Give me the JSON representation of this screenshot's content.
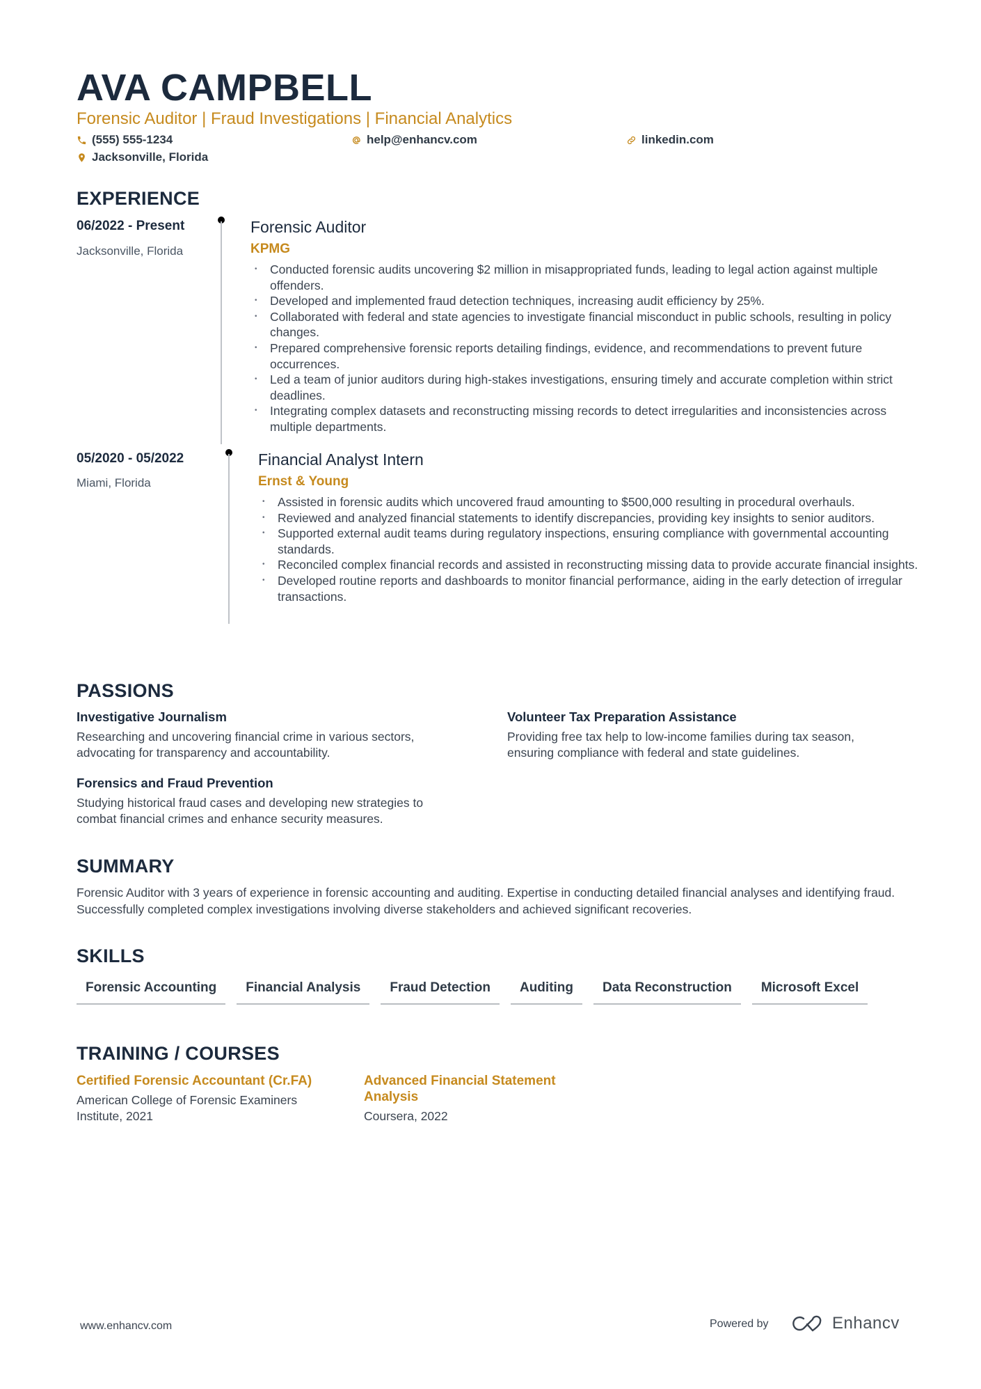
{
  "header": {
    "name": "AVA CAMPBELL",
    "headline": "Forensic Auditor | Fraud Investigations | Financial Analytics",
    "contacts": {
      "phone": {
        "icon": "phone-icon",
        "value": "(555) 555-1234"
      },
      "email": {
        "icon": "at-icon",
        "value": "help@enhancv.com"
      },
      "website": {
        "icon": "link-icon",
        "value": "linkedin.com"
      },
      "location": {
        "icon": "location-pin-icon",
        "value": "Jacksonville, Florida"
      }
    }
  },
  "colors": {
    "accent": "#c68a1e",
    "heading": "#1c2a3d",
    "text": "#3b4450"
  },
  "experience": {
    "title": "EXPERIENCE",
    "items": [
      {
        "dates": "06/2022 - Present",
        "location": "Jacksonville, Florida",
        "role": "Forensic Auditor",
        "company": "KPMG",
        "bullets": [
          "Conducted forensic audits uncovering $2 million in misappropriated funds, leading to legal action against multiple offenders.",
          "Developed and implemented fraud detection techniques, increasing audit efficiency by 25%.",
          "Collaborated with federal and state agencies to investigate financial misconduct in public schools, resulting in policy changes.",
          "Prepared comprehensive forensic reports detailing findings, evidence, and recommendations to prevent future occurrences.",
          "Led a team of junior auditors during high-stakes investigations, ensuring timely and accurate completion within strict deadlines.",
          "Integrating complex datasets and reconstructing missing records to detect irregularities and inconsistencies across multiple departments."
        ]
      },
      {
        "dates": "05/2020 - 05/2022",
        "location": "Miami, Florida",
        "role": "Financial Analyst Intern",
        "company": "Ernst & Young",
        "bullets": [
          "Assisted in forensic audits which uncovered fraud amounting to $500,000 resulting in procedural overhauls.",
          "Reviewed and analyzed financial statements to identify discrepancies, providing key insights to senior auditors.",
          "Supported external audit teams during regulatory inspections, ensuring compliance with governmental accounting standards.",
          "Reconciled complex financial records and assisted in reconstructing missing data to provide accurate financial insights.",
          "Developed routine reports and dashboards to monitor financial performance, aiding in the early detection of irregular transactions."
        ]
      }
    ]
  },
  "passions": {
    "title": "PASSIONS",
    "items": [
      {
        "title": "Investigative Journalism",
        "description": "Researching and uncovering financial crime in various sectors, advocating for transparency and accountability."
      },
      {
        "title": "Volunteer Tax Preparation Assistance",
        "description": "Providing free tax help to low-income families during tax season, ensuring compliance with federal and state guidelines."
      },
      {
        "title": "Forensics and Fraud Prevention",
        "description": "Studying historical fraud cases and developing new strategies to combat financial crimes and enhance security measures."
      }
    ]
  },
  "summary": {
    "title": "SUMMARY",
    "text": "Forensic Auditor with 3 years of experience in forensic accounting and auditing. Expertise in conducting detailed financial analyses and identifying fraud. Successfully completed complex investigations involving diverse stakeholders and achieved significant recoveries."
  },
  "skills": {
    "title": "SKILLS",
    "items": [
      "Forensic Accounting",
      "Financial Analysis",
      "Fraud Detection",
      "Auditing",
      "Data Reconstruction",
      "Microsoft Excel"
    ]
  },
  "training": {
    "title": "TRAINING / COURSES",
    "items": [
      {
        "title": "Certified Forensic Accountant (Cr.FA)",
        "organization": "American College of Forensic Examiners Institute, 2021"
      },
      {
        "title": "Advanced Financial Statement Analysis",
        "organization": "Coursera, 2022"
      }
    ]
  },
  "footer": {
    "url": "www.enhancv.com",
    "powered_by": "Powered by",
    "brand": "Enhancv",
    "brand_icon": "enhancv-logo-icon"
  }
}
